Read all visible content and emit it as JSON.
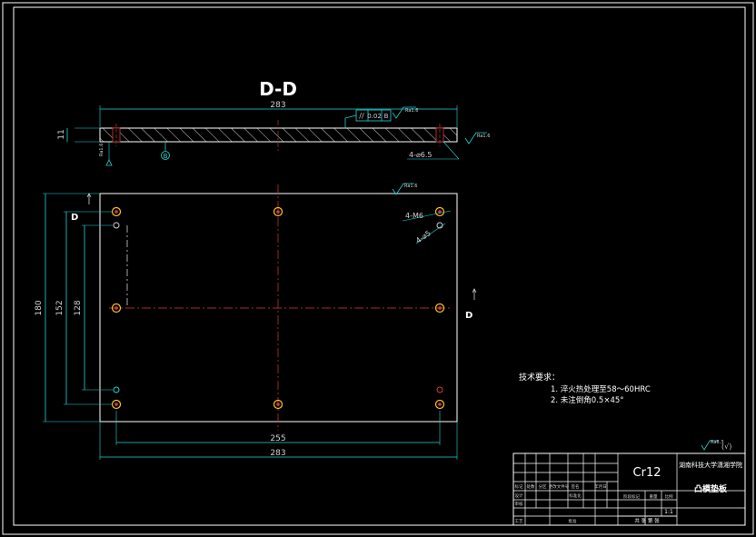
{
  "section_title": "D-D",
  "section_marker": "D",
  "dimensions": {
    "top_width": "283",
    "thickness": "11",
    "holes_top": "4-⌀6.5",
    "holes_m6": "4-M6",
    "holes_5": "4-⌀5",
    "left_outer": "180",
    "left_mid": "152",
    "left_inner": "128",
    "bottom_inner": "255",
    "bottom_outer": "283"
  },
  "tolerance": {
    "symbol": "//",
    "value": "0.02",
    "datum": "B",
    "datum_marker": "B"
  },
  "roughness": {
    "value": "Ra1.6",
    "general": "Ra6.3"
  },
  "notes": {
    "heading": "技术要求：",
    "items": [
      "1.  淬火热处理至58～60HRC",
      "2.  未注倒角0.5×45°"
    ]
  },
  "title_block": {
    "material": "Cr12",
    "school": "湖南科技大学潇湘学院",
    "part_name": "凸模垫板",
    "scale": "1:1",
    "sheet": "共 张  第 张",
    "grid_labels": [
      "标记",
      "处数",
      "分区",
      "更改文件号",
      "签名",
      "年月日",
      "设计",
      "标准化",
      "审核",
      "工艺",
      "批准",
      "阶段标记",
      "重量",
      "比例"
    ]
  }
}
